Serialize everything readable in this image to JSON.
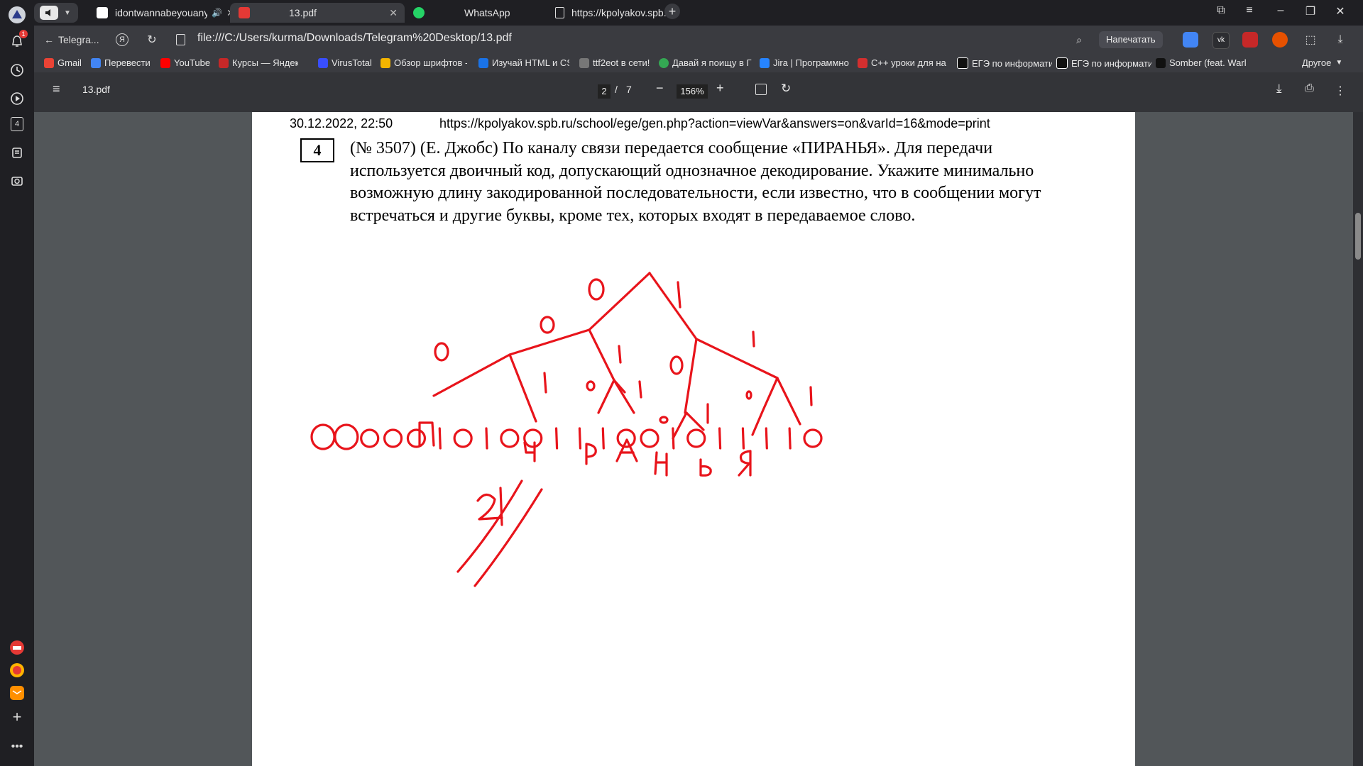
{
  "tabs": [
    {
      "label": "idontwannabeyouanymore",
      "active": false
    },
    {
      "label": "13.pdf",
      "active": true
    },
    {
      "label": "WhatsApp",
      "active": false
    },
    {
      "label": "https://kpolyakov.spb.ru",
      "active": false
    }
  ],
  "address": {
    "site_label": "Telegra...",
    "url": "file:///C:/Users/kurma/Downloads/Telegram%20Desktop/13.pdf",
    "print_label": "Напечатать"
  },
  "bookmarks": [
    "Gmail",
    "Перевести",
    "YouTube",
    "Курсы — Яндекс.Л",
    "VirusTotal",
    "Обзор шрифтов -",
    "Изучай HTML и CSS",
    "ttf2eot в сети!",
    "Давай я поищу в Г",
    "Jira | Программно",
    "C++ уроки для на",
    "ЕГЭ по информати",
    "ЕГЭ по информати",
    "Somber (feat. Warl"
  ],
  "bookmarks_other": "Другое",
  "sidebar_badge": "1",
  "sidebar_number": "4",
  "pdf": {
    "filename": "13.pdf",
    "page_current": "2",
    "page_sep": "/",
    "page_total": "7",
    "zoom": "156%"
  },
  "document": {
    "header_date": "30.12.2022, 22:50",
    "header_url": "https://kpolyakov.spb.ru/school/ege/gen.php?action=viewVar&answers=on&varId=16&mode=print",
    "question_number": "4",
    "question_text": "(№ 3507) (Е. Джобс) По каналу связи передается сообщение «ПИРАНЬЯ». Для передачи используется двоичный код, допускающий однозначное декодирование. Укажите минимально возможную длину закодированной последовательности, если известно, что в сообщении могут встречаться и другие буквы, кроме тех, которых входят в передаваемое слово."
  },
  "annotations": {
    "ink_color": "#e8141b",
    "tree_labels": [
      "0",
      "1",
      "0",
      "1",
      "0",
      "1",
      "1",
      "0",
      "1",
      "0",
      "1",
      "0",
      "1",
      "1",
      "0"
    ],
    "leaf_letters": [
      "П",
      "Ч",
      "Р",
      "А",
      "Н",
      "Ь",
      "Я"
    ],
    "code_sequence": "0000010100111001011110",
    "answer": "21"
  },
  "colors": {
    "chrome_dark": "#1f1f23",
    "toolbar": "#3a3b40",
    "pdf_toolbar": "#333438",
    "viewer_bg": "#525659"
  }
}
